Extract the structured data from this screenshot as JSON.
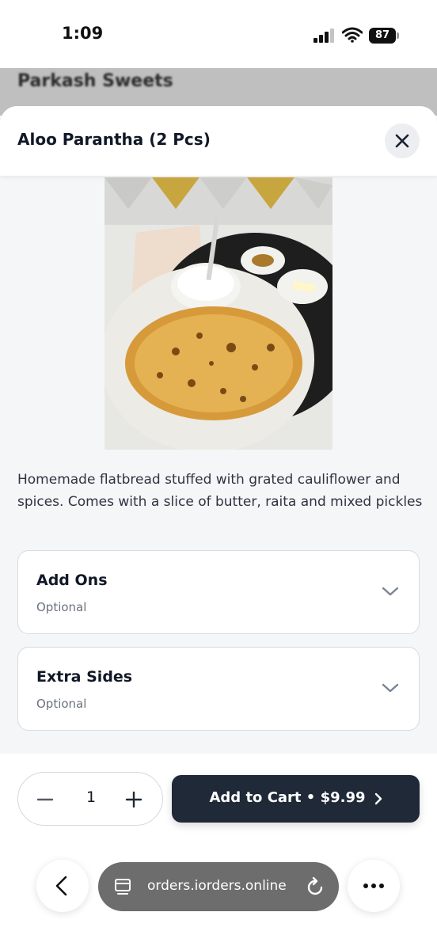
{
  "status_bar": {
    "time": "1:09",
    "battery": "87"
  },
  "background_page": {
    "restaurant_name": "Parkash Sweets"
  },
  "item": {
    "title": "Aloo Parantha (2 Pcs)",
    "image_alt": "Aloo parantha served with raita, pickle and butter",
    "description": "Homemade flatbread stuffed with grated cauliflower and spices. Comes with a slice of butter, raita and mixed pickles"
  },
  "options": [
    {
      "title": "Add Ons",
      "subtitle": "Optional"
    },
    {
      "title": "Extra Sides",
      "subtitle": "Optional"
    }
  ],
  "cart": {
    "quantity": "1",
    "add_label": "Add to Cart • $9.99"
  },
  "browser": {
    "url": "orders.iorders.online"
  },
  "colors": {
    "primary_button": "#1f2937",
    "url_pill": "#6d6d6d"
  }
}
